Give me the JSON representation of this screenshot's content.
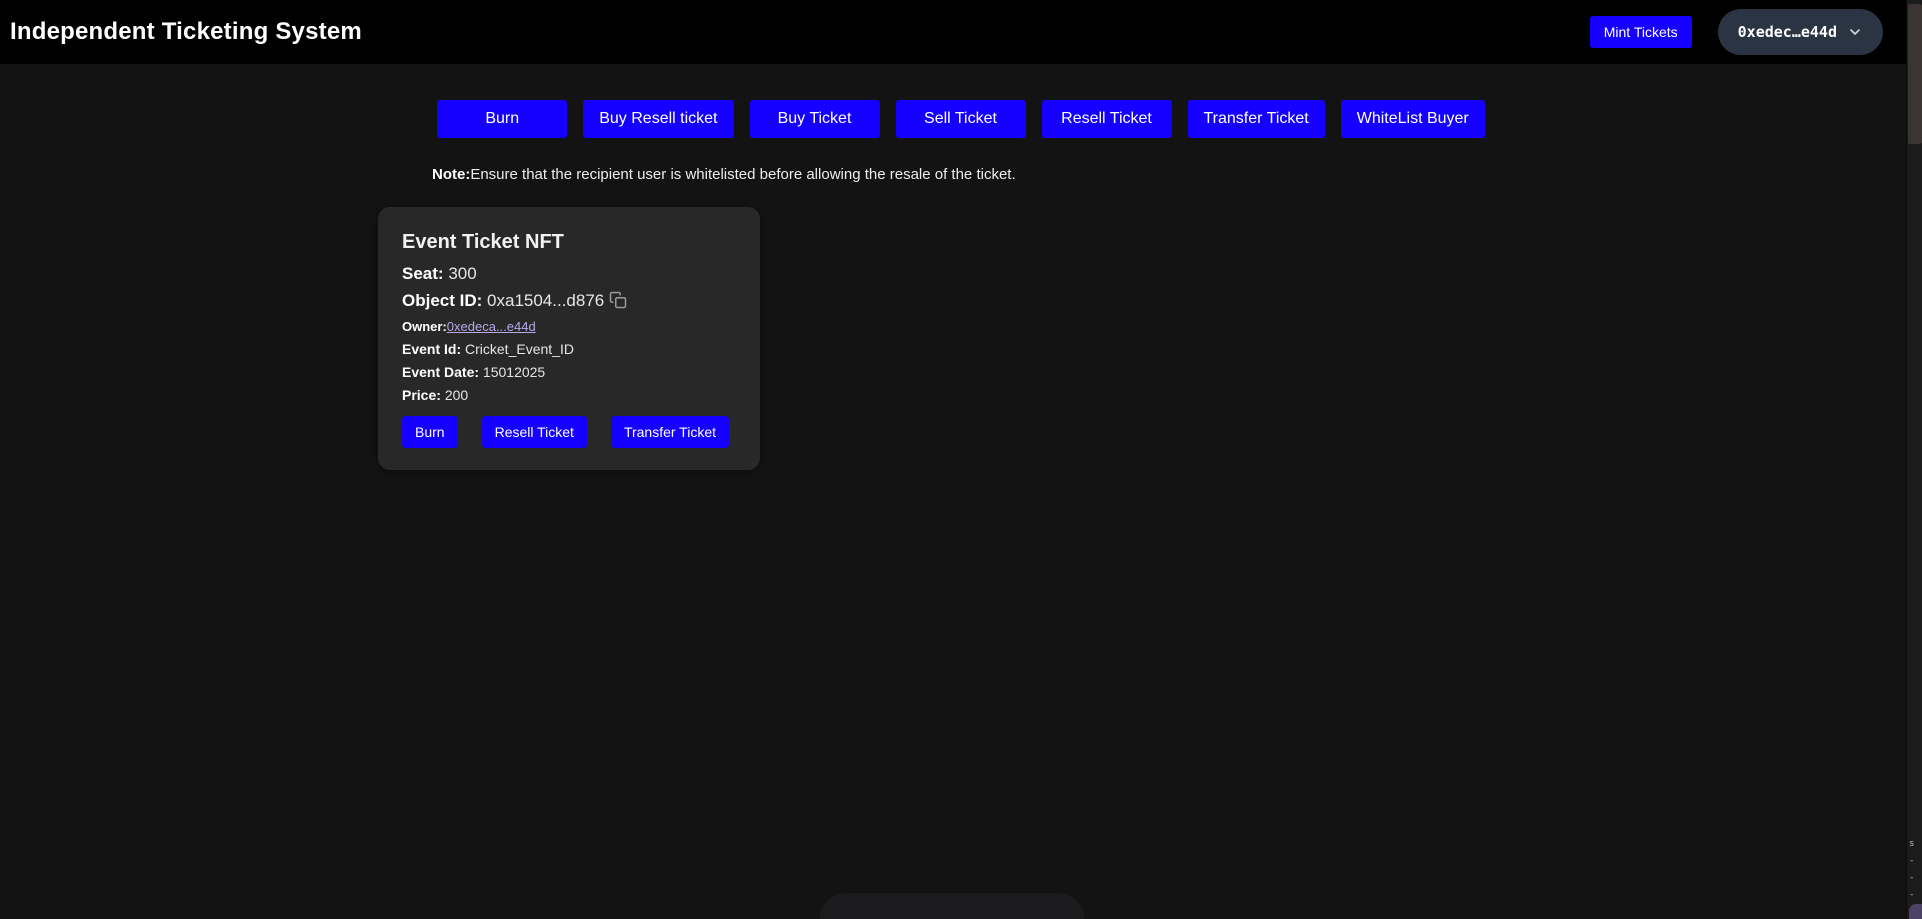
{
  "theme": {
    "page_bg": "#131314",
    "navbar_bg": "#000000",
    "accent_blue": "#1500ff",
    "wallet_pill_bg": "#2b3442",
    "card_bg": "#282828",
    "link_purple": "#b9a8ea",
    "copy_icon_gray": "#9b9b9b",
    "scrollbar_thumb": "#3a3433"
  },
  "navbar": {
    "title": "Independent Ticketing System",
    "mint_button_label": "Mint Tickets",
    "wallet_address": "0xedec…e44d",
    "chevron_icon": "chevron-down-icon"
  },
  "actions": {
    "buttons": [
      "Burn",
      "Buy Resell ticket",
      "Buy Ticket",
      "Sell Ticket",
      "Resell Ticket",
      "Transfer Ticket",
      "WhiteList Buyer"
    ]
  },
  "note": {
    "label": "Note:",
    "text": "Ensure that the recipient user is whitelisted before allowing the resale of the ticket."
  },
  "ticket_card": {
    "title": "Event Ticket NFT",
    "seat_label": "Seat:",
    "seat_value": "300",
    "object_id_label": "Object ID:",
    "object_id_value": "0xa1504...d876",
    "copy_icon": "copy-icon",
    "owner_label": "Owner:",
    "owner_value": "0xedeca...e44d",
    "event_id_label": "Event Id:",
    "event_id_value": "Cricket_Event_ID",
    "event_date_label": "Event Date:",
    "event_date_value": "15012025",
    "price_label": "Price:",
    "price_value": "200",
    "buttons": [
      "Burn",
      "Resell Ticket",
      "Transfer Ticket"
    ]
  },
  "right_edge": {
    "marks": [
      "s",
      "-",
      "-",
      "-"
    ]
  }
}
